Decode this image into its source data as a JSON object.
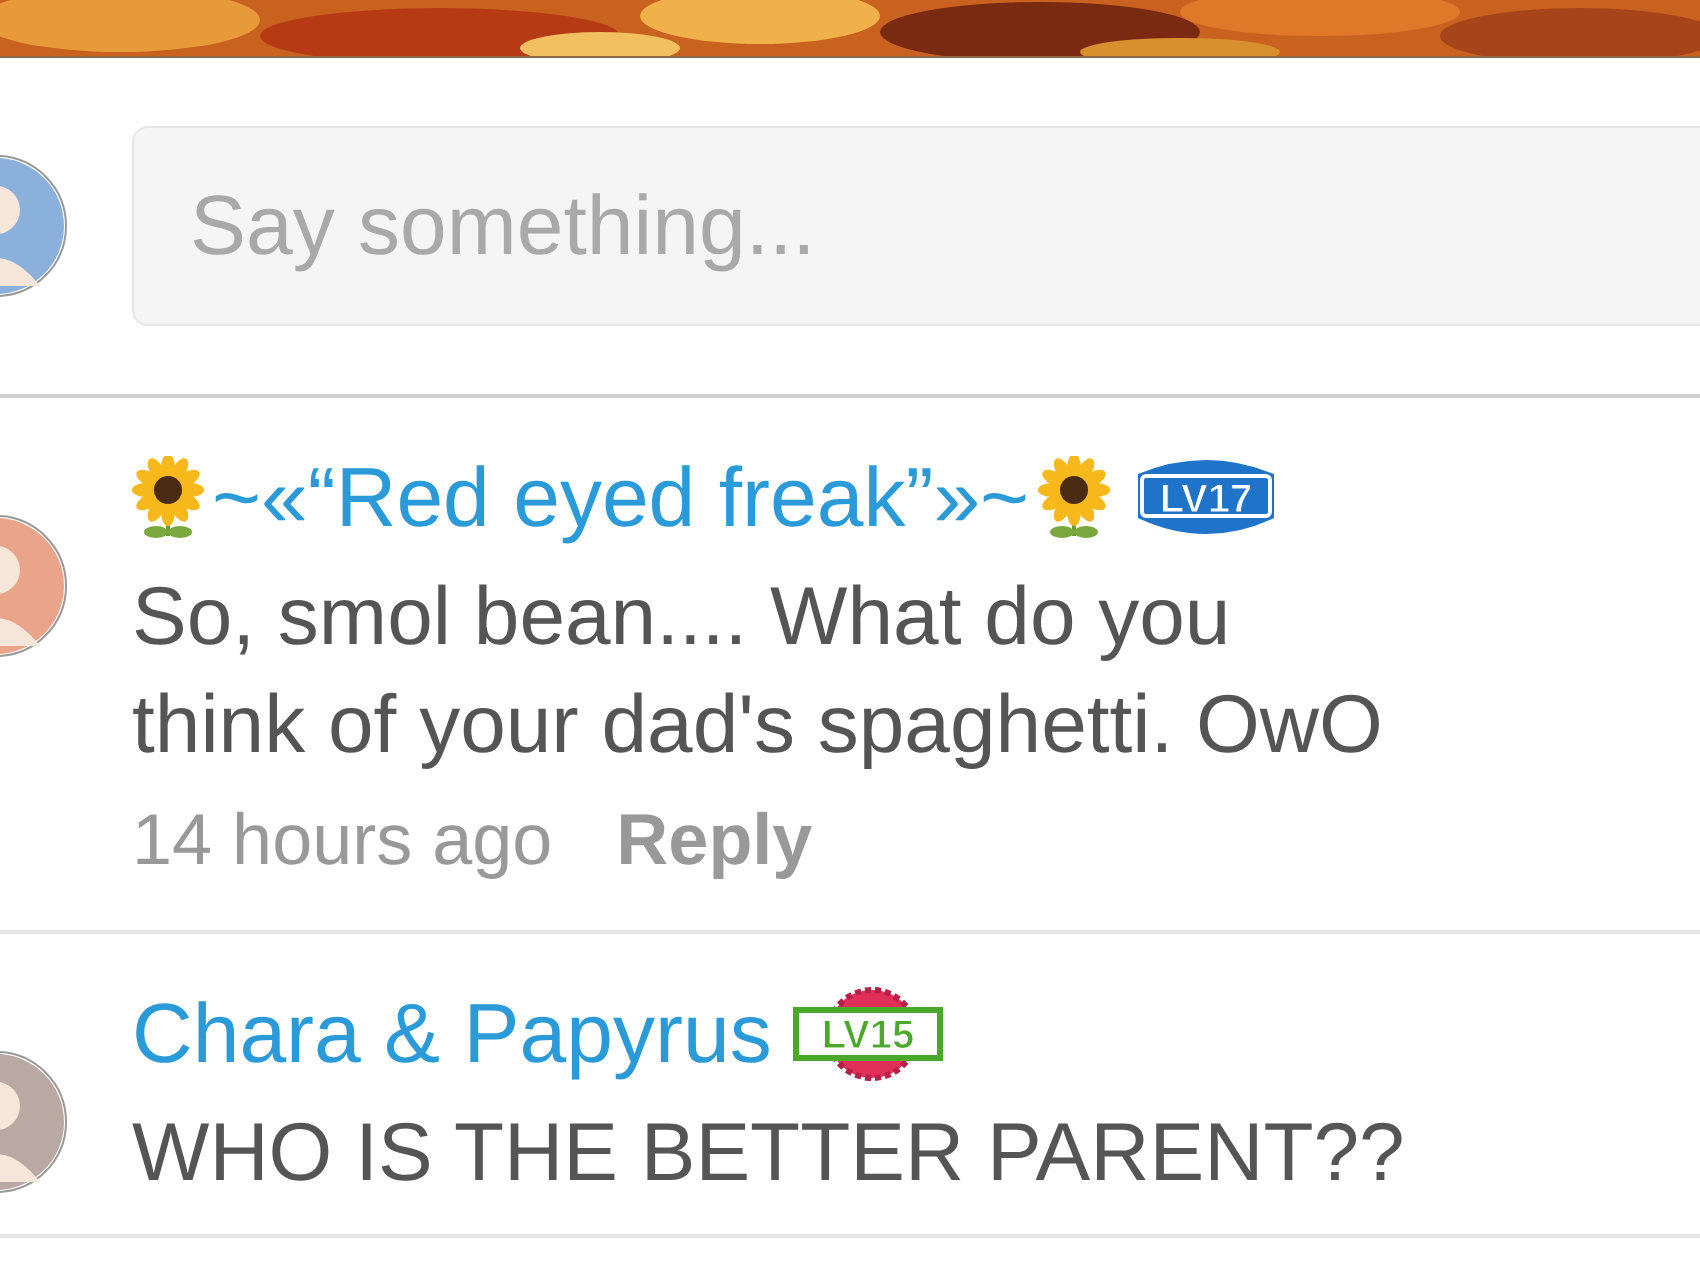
{
  "composer": {
    "placeholder": "Say something..."
  },
  "comments": [
    {
      "name_parts": [
        {
          "kind": "sunflower"
        },
        {
          "kind": "text",
          "text": "~«“Red eyed freak”»~"
        },
        {
          "kind": "sunflower"
        }
      ],
      "badge": {
        "label": "LV17",
        "kind": "shield"
      },
      "text": "So, smol bean.... What do you\nthink of your dad's spaghetti. OwO",
      "time": "14 hours ago",
      "reply": "Reply"
    },
    {
      "name_parts": [
        {
          "kind": "text",
          "text": "Chara & Papyrus"
        }
      ],
      "badge": {
        "label": "LV15",
        "kind": "rosette"
      },
      "text": "WHO IS THE BETTER PARENT??"
    }
  ]
}
